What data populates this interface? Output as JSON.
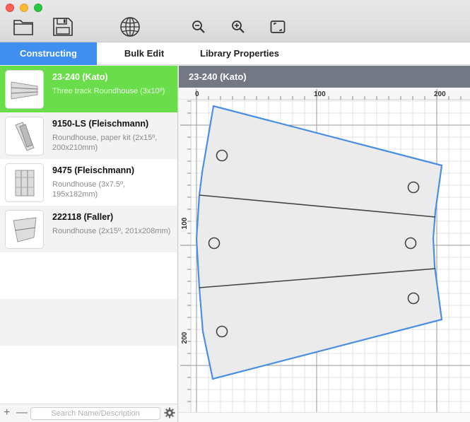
{
  "toolbar": {
    "buttons": [
      {
        "name": "open-folder-button",
        "icon": "folder-icon"
      },
      {
        "name": "save-button",
        "icon": "floppy-disk-icon"
      },
      {
        "name": "library-button",
        "icon": "globe-icon"
      },
      {
        "name": "zoom-out-button",
        "icon": "zoom-out-icon"
      },
      {
        "name": "zoom-in-button",
        "icon": "zoom-in-icon"
      },
      {
        "name": "fit-to-window-button",
        "icon": "fit-screen-icon"
      }
    ]
  },
  "tabs": [
    {
      "label": "Constructing",
      "active": true
    },
    {
      "label": "Bulk Edit",
      "active": false
    },
    {
      "label": "Library Properties",
      "active": false
    }
  ],
  "sidebar": {
    "items": [
      {
        "title": "23-240 (Kato)",
        "desc": "Three track Roundhouse (3x10º)",
        "selected": true
      },
      {
        "title": "9150-LS (Fleischmann)",
        "desc": "Roundhouse, paper kit (2x15º, 200x210mm)",
        "selected": false
      },
      {
        "title": "9475 (Fleischmann)",
        "desc": "Roundhouse (3x7.5º, 195x182mm)",
        "selected": false
      },
      {
        "title": "222118 (Faller)",
        "desc": "Roundhouse (2x15º, 201x208mm)",
        "selected": false
      }
    ],
    "add_label": "+",
    "remove_label": "—",
    "search_placeholder": "Search Name/Description",
    "search_value": ""
  },
  "editor": {
    "title": "23-240 (Kato)",
    "ruler_top_labels": [
      "0",
      "100",
      "200"
    ],
    "ruler_left_labels": [
      "100",
      "200"
    ]
  },
  "colors": {
    "selection": "#69dd4a",
    "tab_active": "#3f8ff0",
    "header": "#747884",
    "shape_outline": "#4a8fe0"
  }
}
